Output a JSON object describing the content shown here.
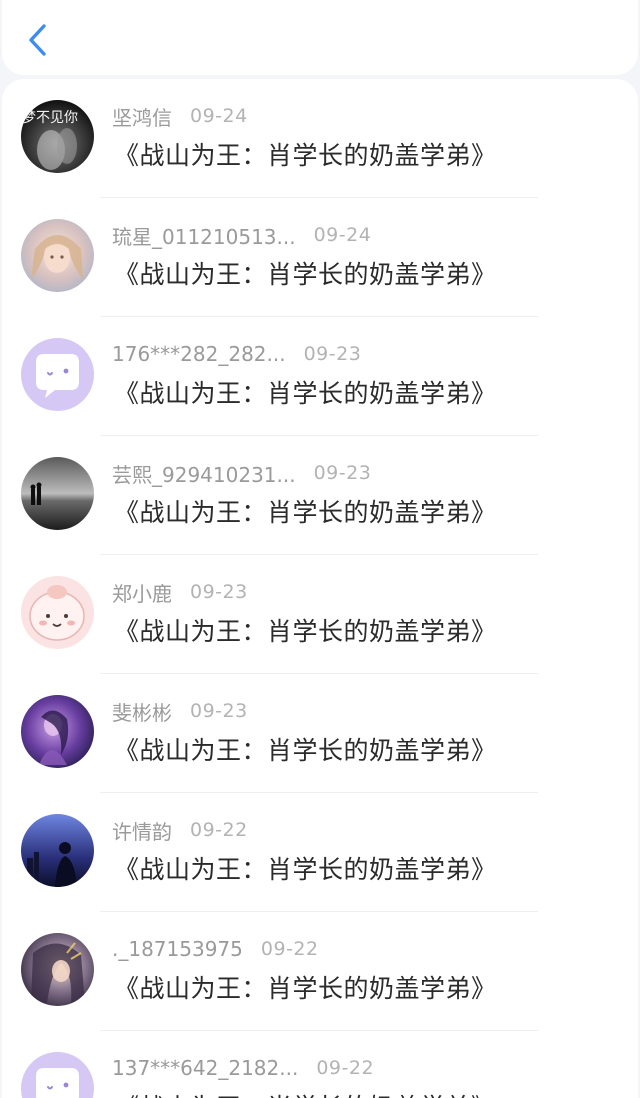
{
  "header": {
    "back_icon": "chevron-left-icon",
    "accent_color": "#3d8cf0"
  },
  "entries": [
    {
      "username": "坚鸿信",
      "date": "09-24",
      "book_title": "《战山为王：肖学长的奶盖学弟》",
      "avatar_text": "梦不见你"
    },
    {
      "username": "琉星_011210513...",
      "date": "09-24",
      "book_title": "《战山为王：肖学长的奶盖学弟》"
    },
    {
      "username": "176***282_282...",
      "date": "09-23",
      "book_title": "《战山为王：肖学长的奶盖学弟》"
    },
    {
      "username": "芸熙_929410231...",
      "date": "09-23",
      "book_title": "《战山为王：肖学长的奶盖学弟》"
    },
    {
      "username": "郑小鹿",
      "date": "09-23",
      "book_title": "《战山为王：肖学长的奶盖学弟》"
    },
    {
      "username": "斐彬彬",
      "date": "09-23",
      "book_title": "《战山为王：肖学长的奶盖学弟》"
    },
    {
      "username": "许情韵",
      "date": "09-22",
      "book_title": "《战山为王：肖学长的奶盖学弟》"
    },
    {
      "username": "._187153975",
      "date": "09-22",
      "book_title": "《战山为王：肖学长的奶盖学弟》"
    },
    {
      "username": "137***642_2182...",
      "date": "09-22",
      "book_title": "《战山为王：肖学长的奶盖学弟》"
    }
  ]
}
